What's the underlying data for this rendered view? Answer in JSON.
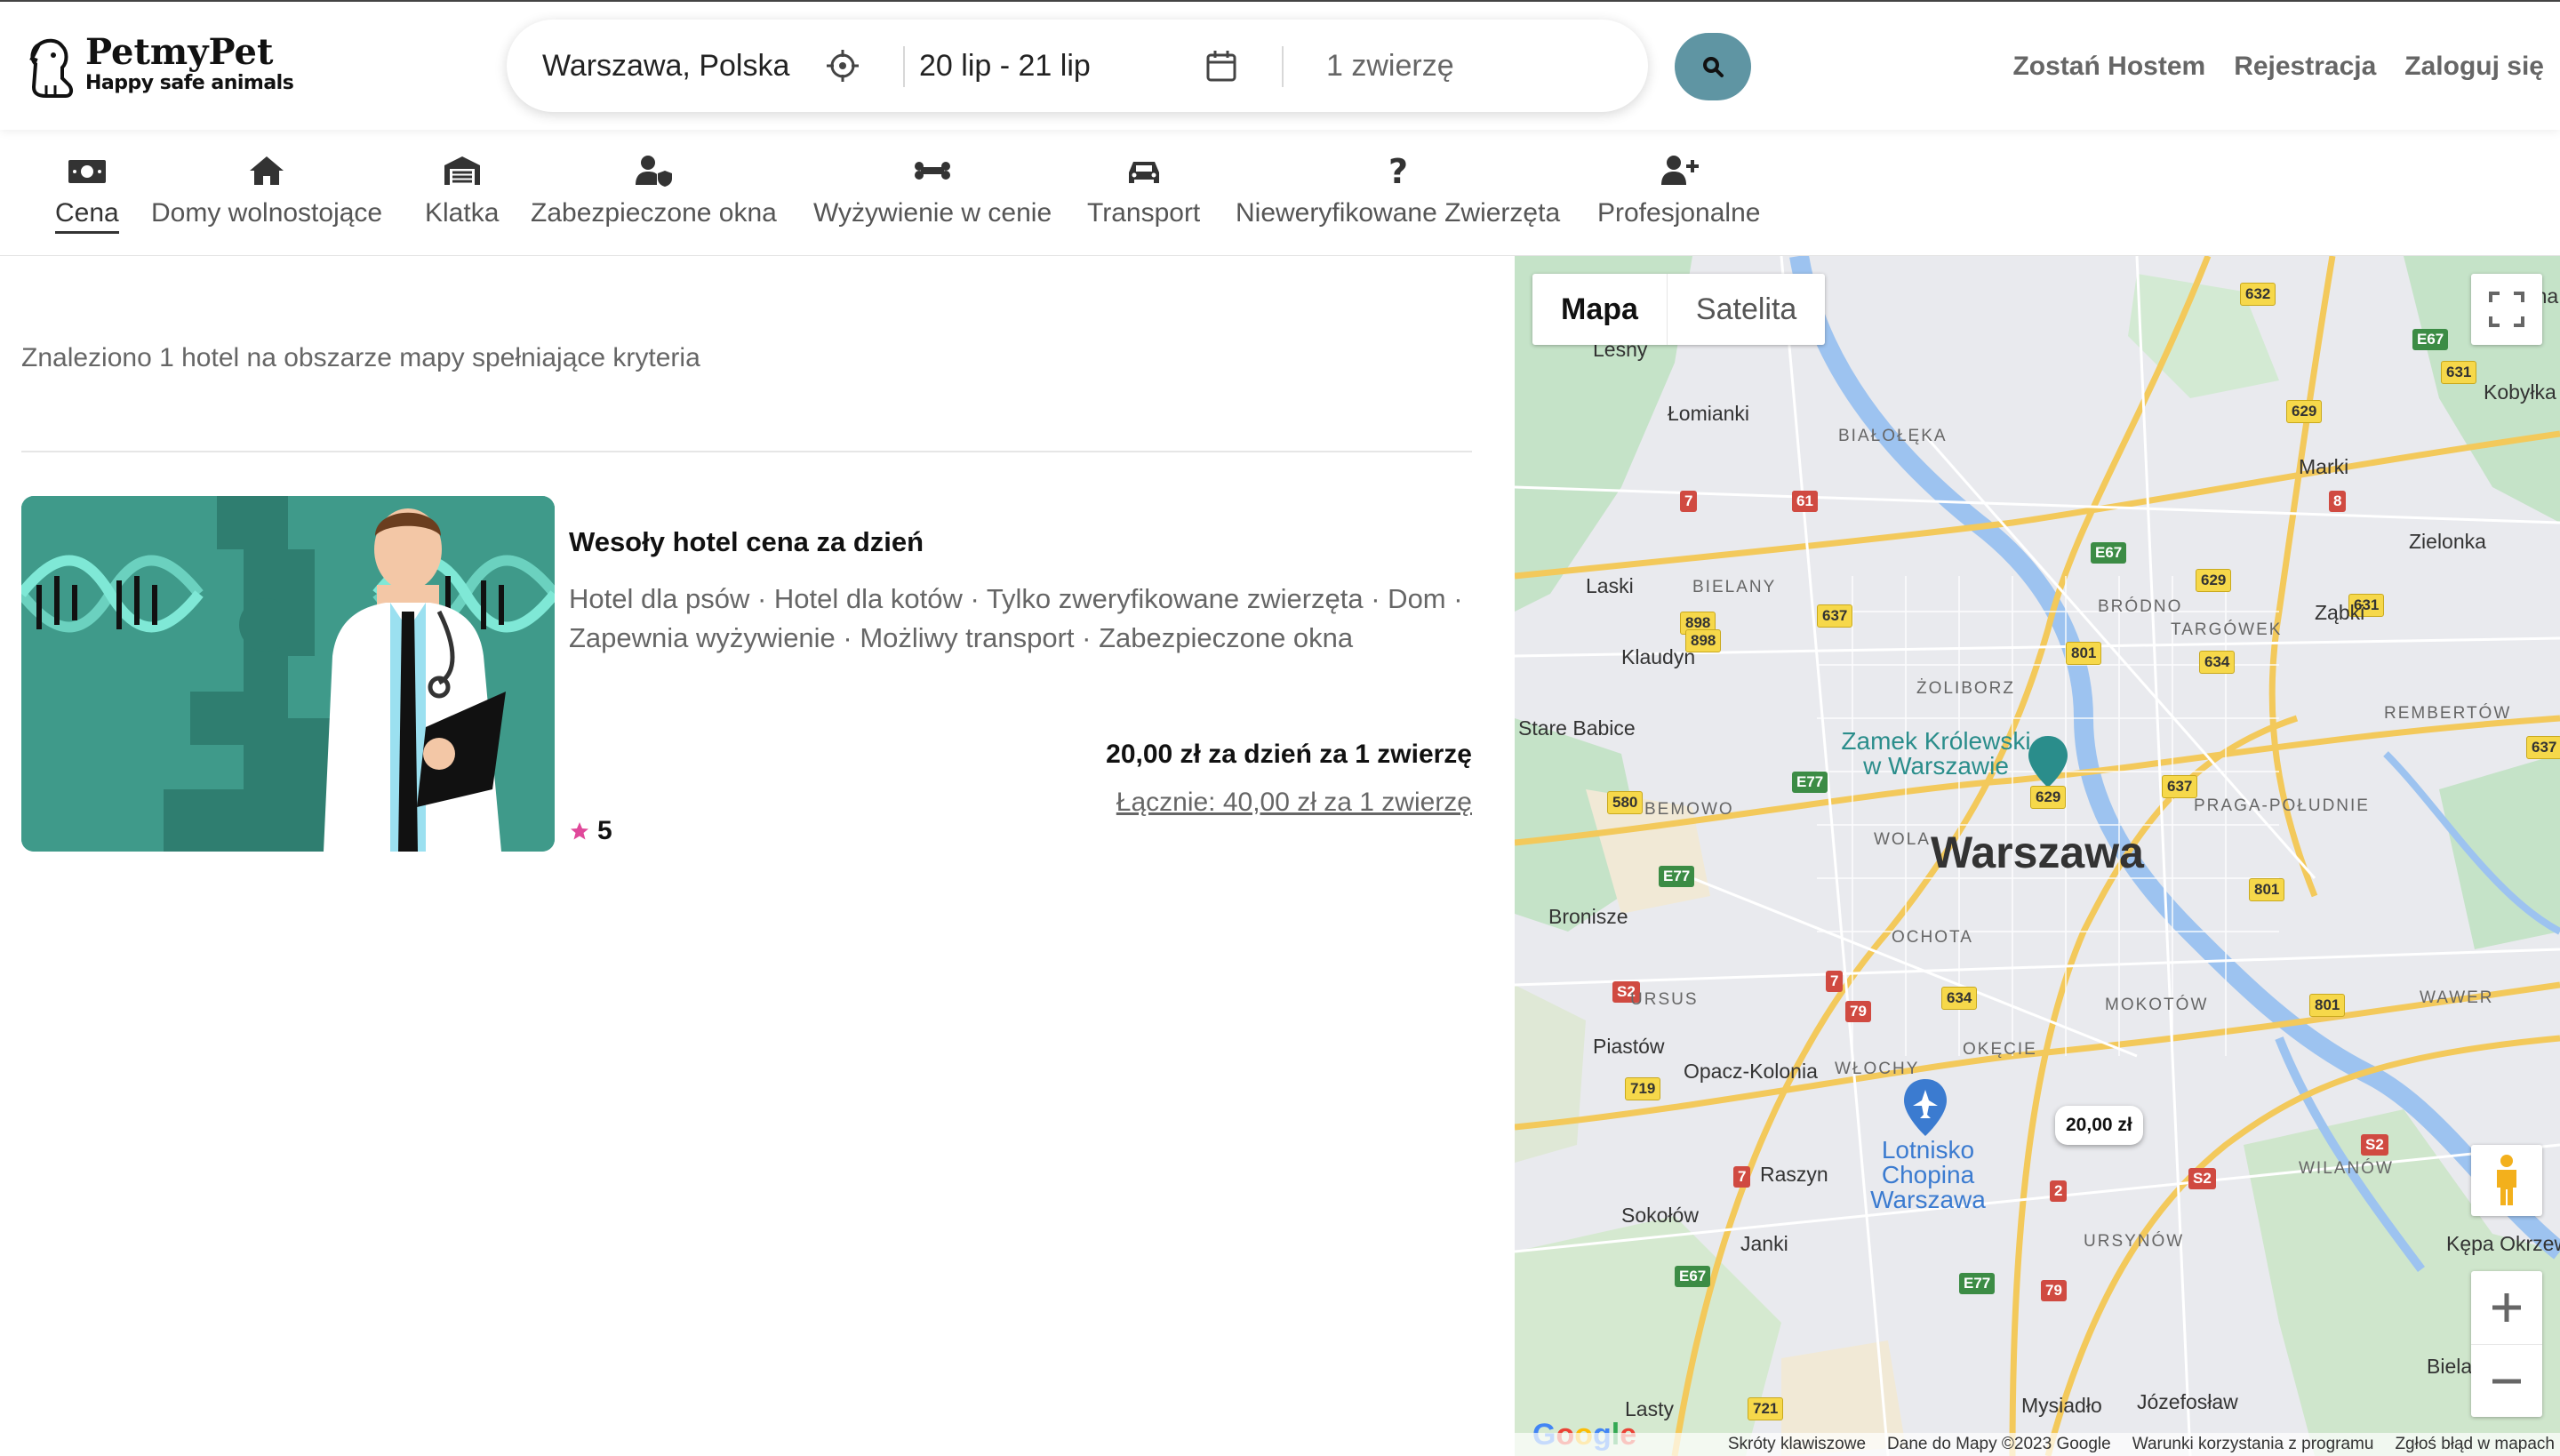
{
  "header": {
    "logo_name": "PetmyPet",
    "logo_tagline": "Happy safe animals",
    "search": {
      "location": "Warszawa, Polska",
      "dates": "20 lip - 21 lip",
      "pets": "1 zwierzę"
    },
    "links": [
      "Zostań Hostem",
      "Rejestracja",
      "Zaloguj się"
    ]
  },
  "filters": [
    {
      "label": "Cena",
      "icon": "money-icon",
      "active": true
    },
    {
      "label": "Domy wolnostojące",
      "icon": "house-icon"
    },
    {
      "label": "Klatka",
      "icon": "warehouse-icon"
    },
    {
      "label": "Zabezpieczone okna",
      "icon": "user-shield-icon"
    },
    {
      "label": "Wyżywienie w cenie",
      "icon": "bone-icon"
    },
    {
      "label": "Transport",
      "icon": "car-icon"
    },
    {
      "label": "Nieweryfikowane Zwierzęta",
      "icon": "question-icon"
    },
    {
      "label": "Profesjonalne",
      "icon": "user-plus-icon"
    }
  ],
  "results": {
    "summary": "Znaleziono 1 hotel na obszarze mapy spełniające kryteria"
  },
  "listing": {
    "title": "Wesoły hotel cena za dzień",
    "features": "Hotel dla psów · Hotel dla kotów · Tylko zweryfikowane zwierzęta · Dom · Zapewnia wyżywienie · Możliwy transport · Zabezpieczone okna",
    "price": "20,00 zł za dzień za 1 zwierzę",
    "total": "Łącznie: 40,00 zł za 1 zwierzę",
    "rating": "5"
  },
  "map": {
    "type_map": "Mapa",
    "type_satellite": "Satelita",
    "marker_price": "20,00 zł",
    "city": "Warszawa",
    "poi_castle": "Zamek Królewski w Warszawie",
    "poi_airport": "Lotnisko Chopina Warszawa",
    "places": [
      {
        "name": "Łomianki"
      },
      {
        "name": "Lasty"
      },
      {
        "name": "Klaudyn"
      },
      {
        "name": "Stare Babice"
      },
      {
        "name": "Bronisze"
      },
      {
        "name": "Piastów"
      },
      {
        "name": "Opacz-Kolonia"
      },
      {
        "name": "Raszyn"
      },
      {
        "name": "Sokołów"
      },
      {
        "name": "Janki"
      },
      {
        "name": "Marki"
      },
      {
        "name": "Ząbki"
      },
      {
        "name": "Zielonka"
      },
      {
        "name": "Kobyłka"
      },
      {
        "name": "Nadma"
      },
      {
        "name": "Kępa Okrzewska"
      },
      {
        "name": "Bielawa"
      },
      {
        "name": "Mysiadło"
      },
      {
        "name": "Józefosław"
      },
      {
        "name": "Lesny"
      },
      {
        "name": "Laski"
      }
    ],
    "districts": [
      "BIAŁOŁĘKA",
      "BIELANY",
      "BRÓDNO",
      "TARGÓWEK",
      "ŻOLIBORZ",
      "REMBERTÓW",
      "BEMOWO",
      "PRAGA-POŁUDNIE",
      "WOLA",
      "OCHOTA",
      "URSUS",
      "MOKOTÓW",
      "WAWER",
      "WŁOCHY",
      "OKĘCIE",
      "WILANÓW",
      "URSYNÓW"
    ],
    "footer": [
      "Skróty klawiszowe",
      "Dane do Mapy ©2023 Google",
      "Warunki korzystania z programu",
      "Zgłoś błąd w mapach"
    ]
  }
}
